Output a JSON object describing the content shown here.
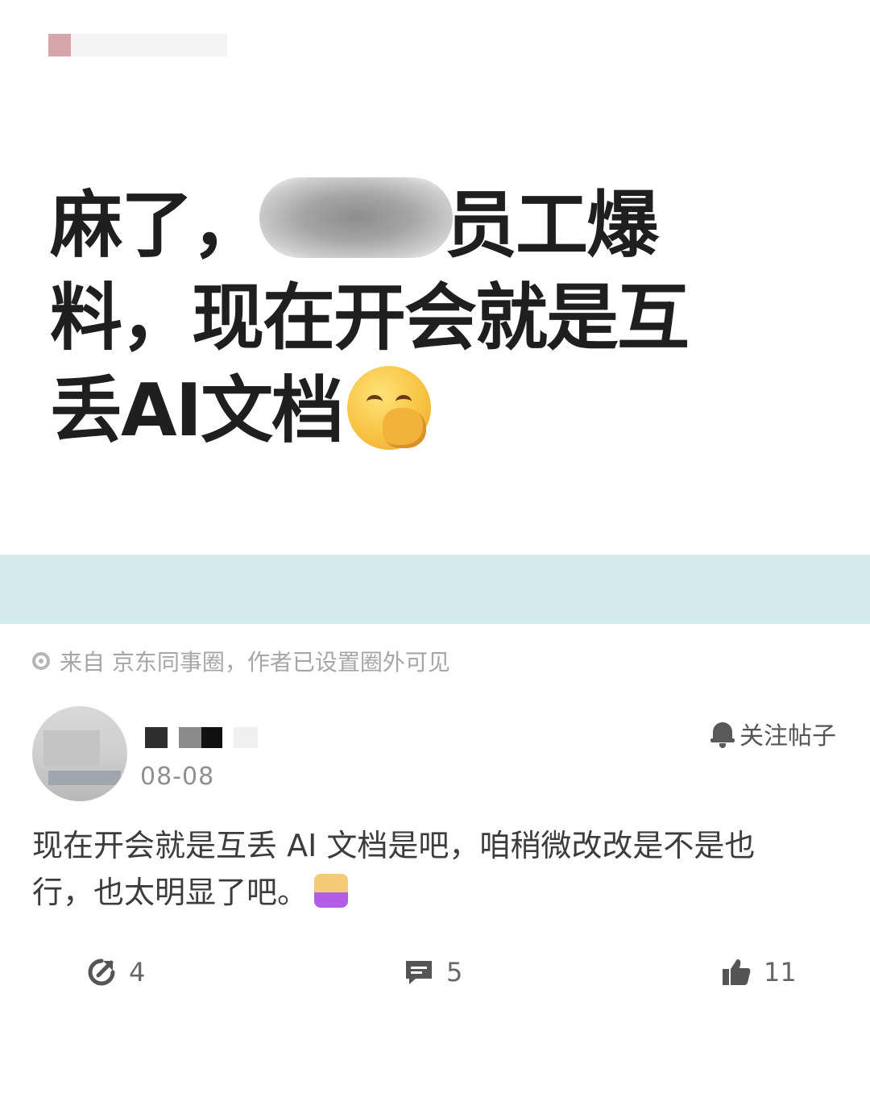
{
  "headline": {
    "line1_start": "麻了，",
    "line1_end": "员工爆",
    "line2": "料，现在开会就是互",
    "line3": "丢AI文档"
  },
  "icons": {
    "headline_emoji": "hand-over-mouth-emoji",
    "source": "circle-dot-icon",
    "follow": "bell-icon",
    "share": "share-icon",
    "comment": "comment-icon",
    "like": "thumbs-up-icon",
    "inline_sticker": "sticker-icon"
  },
  "source": {
    "text": "来自 京东同事圈，作者已设置圈外可见"
  },
  "post": {
    "date": "08-08",
    "follow_label": "关注帖子",
    "content_line1": "现在开会就是互丢 AI 文档是吧，咱稍微改改是不是也",
    "content_line2": "行，也太明显了吧。"
  },
  "actions": {
    "share_count": "4",
    "comment_count": "5",
    "like_count": "11"
  },
  "colors": {
    "band": "#d3ebeb",
    "headline": "#1f1f1f",
    "muted": "#a6a6a6"
  }
}
